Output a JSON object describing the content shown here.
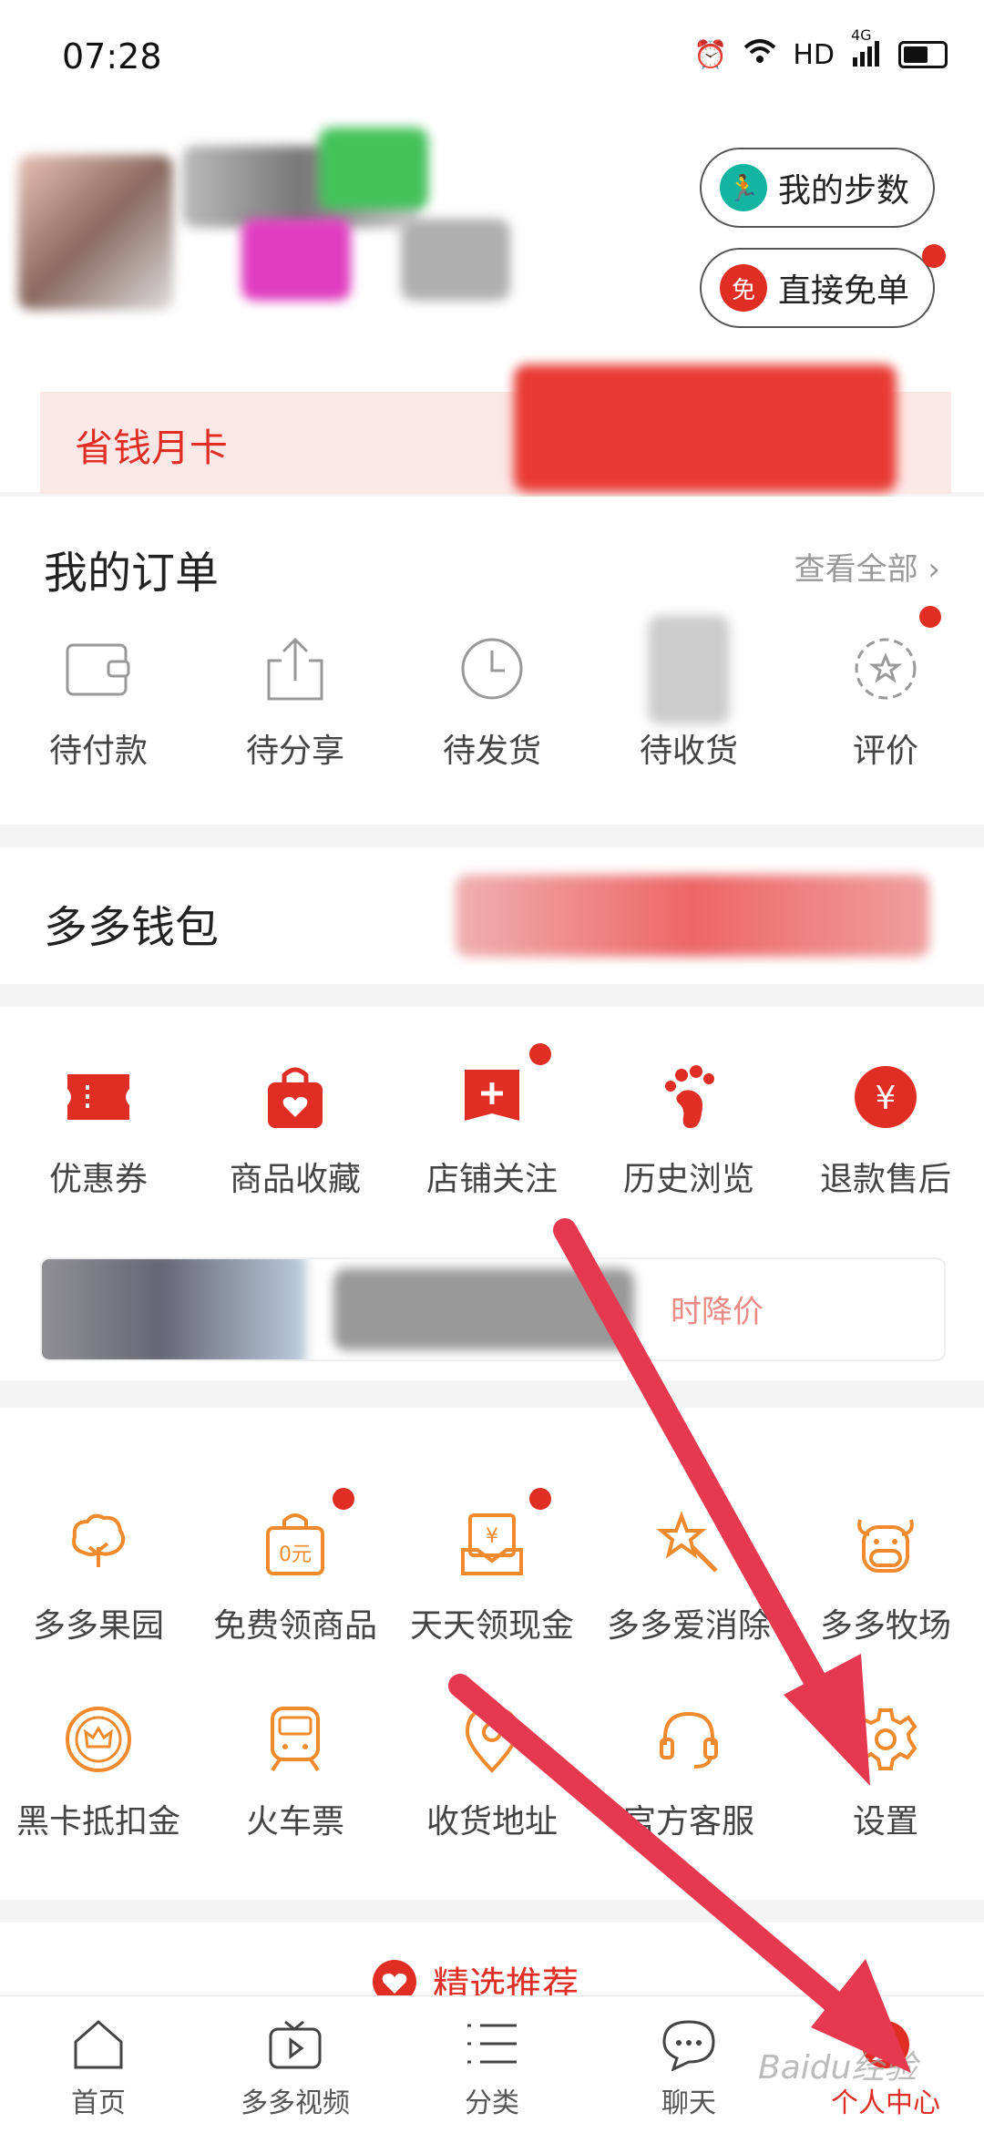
{
  "status_bar": {
    "time": "07:28",
    "network": "HD",
    "signal": "4G"
  },
  "header": {
    "steps_button": "我的步数",
    "free_order_button": "直接免单",
    "free_order_icon": "免",
    "month_card_label": "省钱月卡"
  },
  "orders": {
    "title": "我的订单",
    "see_all": "查看全部",
    "items": [
      {
        "label": "待付款",
        "icon": "wallet-icon"
      },
      {
        "label": "待分享",
        "icon": "share-icon"
      },
      {
        "label": "待发货",
        "icon": "clock-icon"
      },
      {
        "label": "待收货",
        "icon": "truck-icon"
      },
      {
        "label": "评价",
        "icon": "star-icon"
      }
    ]
  },
  "wallet": {
    "title": "多多钱包"
  },
  "shortcuts": {
    "items": [
      {
        "label": "优惠券",
        "icon": "coupon-icon"
      },
      {
        "label": "商品收藏",
        "icon": "favorite-bag-icon"
      },
      {
        "label": "店铺关注",
        "icon": "store-follow-icon"
      },
      {
        "label": "历史浏览",
        "icon": "footprint-icon"
      },
      {
        "label": "退款售后",
        "icon": "refund-icon"
      }
    ],
    "notice": "时降价"
  },
  "services": {
    "row1": [
      {
        "label": "多多果园",
        "icon": "tree-icon"
      },
      {
        "label": "免费领商品",
        "icon": "free-bag-icon",
        "badge": "0元"
      },
      {
        "label": "天天领现金",
        "icon": "cash-icon",
        "badge": "¥"
      },
      {
        "label": "多多爱消除",
        "icon": "star-wand-icon"
      },
      {
        "label": "多多牧场",
        "icon": "cow-icon"
      }
    ],
    "row2": [
      {
        "label": "黑卡抵扣金",
        "icon": "crown-coin-icon"
      },
      {
        "label": "火车票",
        "icon": "train-icon"
      },
      {
        "label": "收货地址",
        "icon": "location-icon"
      },
      {
        "label": "官方客服",
        "icon": "headset-icon"
      },
      {
        "label": "设置",
        "icon": "gear-icon"
      }
    ]
  },
  "recommend": {
    "title": "精选推荐"
  },
  "bottom_nav": [
    {
      "label": "首页",
      "icon": "home-icon"
    },
    {
      "label": "多多视频",
      "icon": "tv-icon"
    },
    {
      "label": "分类",
      "icon": "list-icon"
    },
    {
      "label": "聊天",
      "icon": "chat-icon"
    },
    {
      "label": "个人中心",
      "icon": "avatar-icon",
      "active": true
    }
  ],
  "watermark": "Baidu经验",
  "colors": {
    "accent": "#e02e24",
    "service_orange": "#f08a2c",
    "arrow": "#e63950"
  }
}
